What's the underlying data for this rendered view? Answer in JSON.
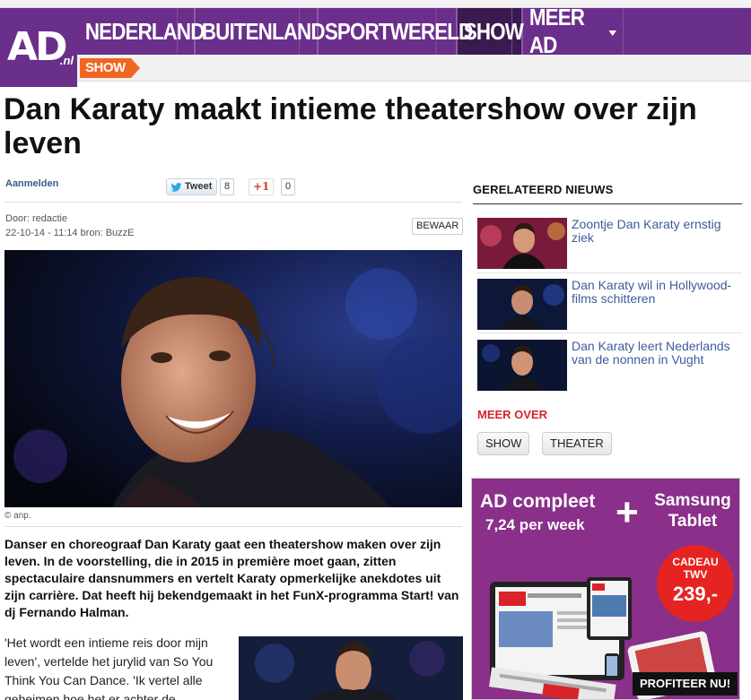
{
  "nav": {
    "logo": "AD",
    "logo_suffix": ".nl",
    "items": [
      "NEDERLAND",
      "BUITENLAND",
      "SPORTWERELD",
      "SHOW",
      "MEER AD"
    ],
    "active": "SHOW",
    "section_tag": "SHOW"
  },
  "article": {
    "headline": "Dan Karaty maakt intieme theatershow over zijn leven",
    "aanmelden": "Aanmelden",
    "tweet_label": "Tweet",
    "tweet_count": "8",
    "gplus_label": "+1",
    "gplus_count": "0",
    "author": "Door: redactie",
    "date_source": "22-10-14 - 11:14  bron: BuzzE",
    "save_label": "BEWAAR",
    "photo_credit": "© anp.",
    "intro": "Danser en choreograaf Dan Karaty gaat een theatershow maken over zijn leven. In de voorstelling, die in 2015 in première moet gaan, zitten spectaculaire dansnummers en vertelt Karaty opmerkelijke anekdotes uit zijn carrière. Dat heeft hij bekendgemaakt in het FunX-programma Start! van dj Fernando Halman.",
    "body": "'Het wordt een intieme reis door mijn leven', vertelde het jurylid van So You Think You Can Dance. 'Ik vertel alle geheimen hoe het er achter de"
  },
  "sidebar": {
    "related_title": "GERELATEERD NIEUWS",
    "related": [
      "Zoontje Dan Karaty ernstig ziek",
      "Dan Karaty wil in Hollywood-films schitteren",
      "Dan Karaty leert Nederlands van de nonnen in Vught"
    ],
    "more_title": "MEER OVER",
    "tags": [
      "SHOW",
      "THEATER"
    ]
  },
  "ad": {
    "line1": "AD compleet",
    "line2": "7,24 per week",
    "right1": "Samsung",
    "right2": "Tablet",
    "gift1": "CADEAU",
    "gift2": "TWV",
    "gift_price": "239,-",
    "cta": "PROFITEER NU!"
  },
  "colors": {
    "brand_purple": "#6a2f8a",
    "active_nav": "#3b1a4f",
    "section_orange": "#f26522",
    "link_blue": "#3d5b9a",
    "accent_red": "#d8232a"
  }
}
